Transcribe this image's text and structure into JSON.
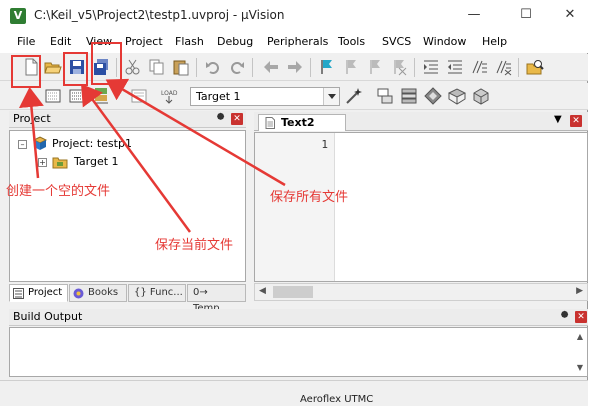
{
  "window": {
    "title": "C:\\Keil_v5\\Project2\\testp1.uvproj - µVision",
    "app_icon": "keil-uvision-icon",
    "controls": [
      "minimize-icon",
      "maximize-icon",
      "close-icon"
    ]
  },
  "menu": [
    "File",
    "Edit",
    "View",
    "Project",
    "Flash",
    "Debug",
    "Peripherals",
    "Tools",
    "SVCS",
    "Window",
    "Help"
  ],
  "toolbar": {
    "target_select": "Target 1"
  },
  "project_panel": {
    "title": "Project",
    "tree": {
      "root": "Project: testp1",
      "child": "Target 1"
    },
    "tabs": [
      "Project",
      "Books",
      "{} Func...",
      "0→ Temp..."
    ]
  },
  "editor": {
    "tab": "Text2",
    "line_numbers": [
      "1"
    ]
  },
  "build_output": {
    "title": "Build Output"
  },
  "background_fragment": "Aeroflex UTMC",
  "annotations": {
    "new_file": "创建一个空的文件",
    "save_current": "保存当前文件",
    "save_all": "保存所有文件"
  },
  "colors": {
    "annotation": "#e53935",
    "close_button": "#c9322f"
  }
}
